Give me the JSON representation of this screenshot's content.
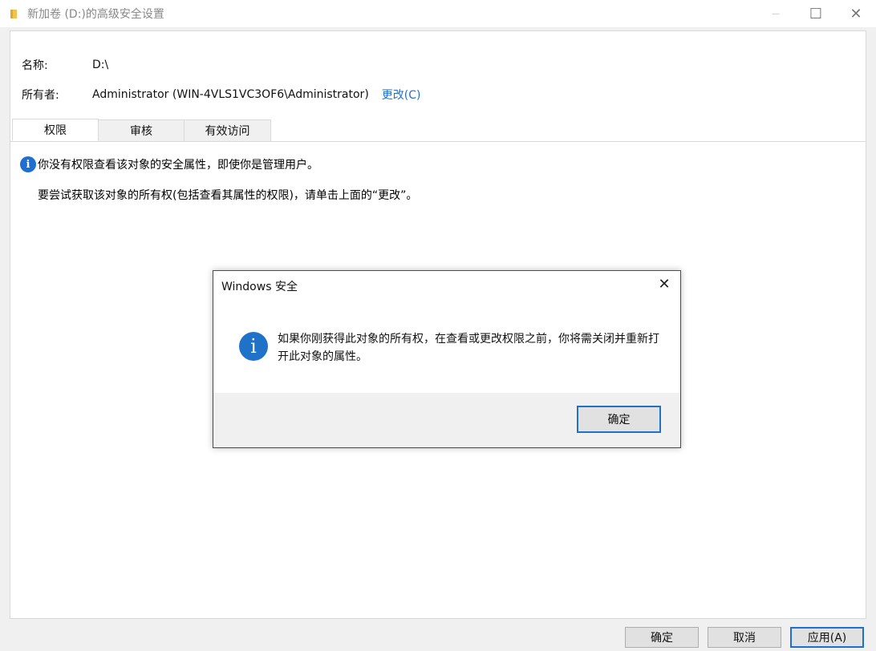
{
  "window": {
    "title": "新加卷 (D:)的高级安全设置",
    "controls": {
      "minimize": "—",
      "maximize": "☐",
      "close": "✕"
    }
  },
  "properties": {
    "name_label": "名称:",
    "name_value": "D:\\",
    "owner_label": "所有者:",
    "owner_value": "Administrator (WIN-4VLS1VC3OF6\\Administrator)",
    "owner_change_link": "更改(C)"
  },
  "tabs": [
    {
      "label": "权限",
      "active": true
    },
    {
      "label": "审核",
      "active": false
    },
    {
      "label": "有效访问",
      "active": false
    }
  ],
  "content": {
    "info_icon": "i",
    "info_text": "你没有权限查看该对象的安全属性，即使你是管理用户。",
    "hint_text": "要尝试获取该对象的所有权(包括查看其属性的权限)，请单击上面的“更改”。"
  },
  "buttons": {
    "ok": "确定",
    "cancel": "取消",
    "apply": "应用(A)"
  },
  "dialog": {
    "title": "Windows 安全",
    "close": "✕",
    "icon": "i",
    "message": "如果你刚获得此对象的所有权，在查看或更改权限之前，你将需关闭并重新打开此对象的属性。",
    "ok": "确定"
  },
  "colors": {
    "accent": "#1f6fd0",
    "link": "#1f6fd0",
    "folder": "#f2c14e"
  }
}
